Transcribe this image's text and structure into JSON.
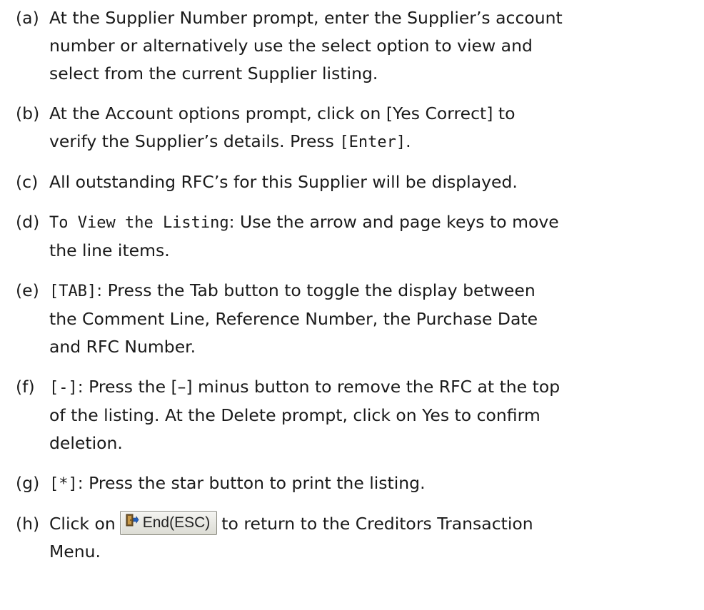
{
  "steps": [
    {
      "marker": "(a)",
      "lines": [
        "At the Supplier Number prompt, enter the Supplier’s account",
        "number or alternatively use the select option to view and",
        "select from the current Supplier listing."
      ]
    },
    {
      "marker": "(b)",
      "line1": "At the Account options prompt, click on [Yes Correct] to",
      "line2_text": "verify the Supplier’s details. Press ",
      "line2_key": "[Enter]",
      "line2_end": "."
    },
    {
      "marker": "(c)",
      "lines": [
        "All outstanding RFC’s for this Supplier will be displayed."
      ]
    },
    {
      "marker": "(d)",
      "line1_mono": "To View the Listing",
      "line1_text": ": Use the arrow and page keys to move",
      "line2": "the line items."
    },
    {
      "marker": "(e)",
      "line1_key": "[TAB]",
      "line1_text": ": Press the Tab button to toggle the display between",
      "line2": "the Comment Line, Reference Number, the Purchase Date",
      "line3": "and RFC Number."
    },
    {
      "marker": "(f)",
      "line1_key": "[-]",
      "line1_text": ": Press the [–] minus button to remove the RFC at the top",
      "line2": "of the listing. At the Delete prompt, click on Yes to confirm",
      "line3": "deletion."
    },
    {
      "marker": "(g)",
      "line1_key": "[*]",
      "line1_text": ": Press the star button to print the listing."
    },
    {
      "marker": "(h)",
      "line1_pre": "Click on",
      "button_label": "End(ESC)",
      "button_icon": "exit-door-icon",
      "line1_post": "to return to the Creditors Transaction",
      "line2": "Menu."
    }
  ]
}
